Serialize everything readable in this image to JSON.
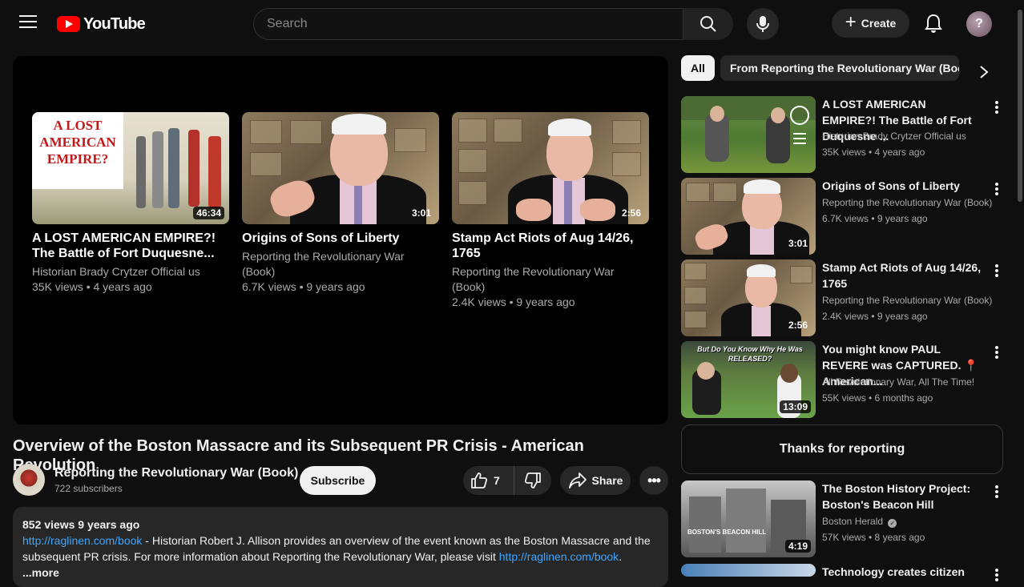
{
  "header": {
    "logo_text": "YouTube",
    "search_placeholder": "Search",
    "create_label": "Create",
    "avatar_initial": "?"
  },
  "player": {
    "endcards": [
      {
        "title": "A LOST AMERICAN EMPIRE?! The Battle of Fort Duquesne...",
        "channel": "Historian Brady Crytzer Official us",
        "meta": "35K views • 4 years ago",
        "duration": "46:34",
        "thumb_text": "A LOST AMERICAN EMPIRE?"
      },
      {
        "title": "Origins of Sons of Liberty",
        "channel": "Reporting the Revolutionary War (Book)",
        "meta": "6.7K views • 9 years ago",
        "duration": "3:01"
      },
      {
        "title": "Stamp Act Riots of Aug 14/26, 1765",
        "channel": "Reporting the Revolutionary War (Book)",
        "meta": "2.4K views • 9 years ago",
        "duration": "2:56"
      }
    ]
  },
  "video": {
    "title": "Overview of the Boston Massacre and its Subsequent PR Crisis - American Revolution",
    "channel_name": "Reporting the Revolutionary War (Book)",
    "subscribers": "722 subscribers",
    "subscribe_label": "Subscribe",
    "like_count": "7",
    "share_label": "Share",
    "description": {
      "stats": "852 views  9 years ago",
      "link1": "http://raglinen.com/book",
      "text1": " - Historian Robert J. Allison provides an overview of the event known as the Boston Massacre and the subsequent PR crisis. For more information about Reporting the Revolutionary War, please visit ",
      "link2": "http://raglinen.com/book",
      "text2": ".",
      "more": "...more"
    }
  },
  "sidebar": {
    "chips": {
      "all": "All",
      "from": "From Reporting the Revolutionary War (Book)"
    },
    "items": [
      {
        "title": "A LOST AMERICAN EMPIRE?! The Battle of Fort Duquesne ...",
        "channel": "Historian Brady Crytzer Official us",
        "meta": "35K views • 4 years ago",
        "duration": ""
      },
      {
        "title": "Origins of Sons of Liberty",
        "channel": "Reporting the Revolutionary War (Book)",
        "meta": "6.7K views • 9 years ago",
        "duration": "3:01"
      },
      {
        "title": "Stamp Act Riots of Aug 14/26, 1765",
        "channel": "Reporting the Revolutionary War (Book)",
        "meta": "2.4K views • 9 years ago",
        "duration": "2:56"
      },
      {
        "title": "You might know PAUL REVERE was CAPTURED. 📍 American...",
        "channel": "All Revolutionary War, All The Time!",
        "meta": "55K views • 6 months ago",
        "duration": "13:09",
        "thumb_text": "But Do You Know Why He Was RELEASED?"
      },
      {
        "title": "The Boston History Project: Boston's Beacon Hill",
        "channel": "Boston Herald",
        "meta": "57K views • 8 years ago",
        "duration": "4:19",
        "thumb_text": "BOSTON'S BEACON HILL"
      },
      {
        "title": "Technology creates citizen",
        "channel": "",
        "meta": "",
        "duration": ""
      }
    ],
    "thanks": "Thanks for reporting"
  },
  "colors": {
    "background": "#0f0f0f",
    "brand_red": "#ff0000",
    "link": "#3ea6ff",
    "pill": "#272727"
  }
}
